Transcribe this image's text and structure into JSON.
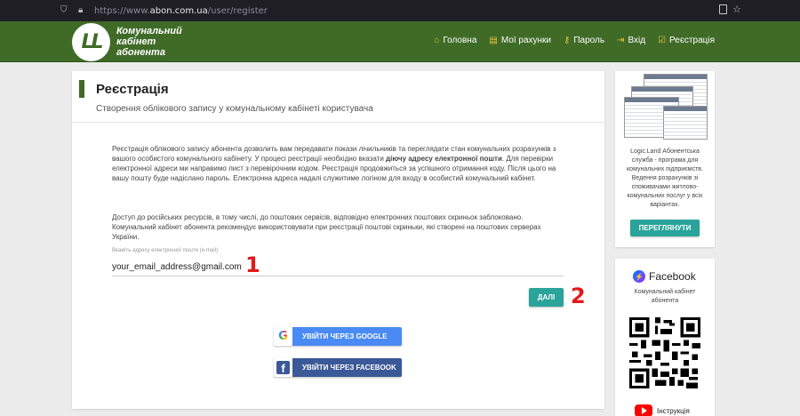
{
  "browser": {
    "url_prefix": "https://www.",
    "url_domain": "abon.com.ua",
    "url_path": "/user/register"
  },
  "header": {
    "logo_mark": "LL",
    "logo_line1": "Комунальний",
    "logo_line2": "кабінет",
    "logo_line3": "абонента",
    "nav": [
      {
        "label": "Головна",
        "icon": "home-icon"
      },
      {
        "label": "Мої рахунки",
        "icon": "receipt-icon"
      },
      {
        "label": "Пароль",
        "icon": "key-icon"
      },
      {
        "label": "Вхід",
        "icon": "login-icon"
      },
      {
        "label": "Реєстрація",
        "icon": "check-icon"
      }
    ]
  },
  "main": {
    "title": "Реєстрація",
    "subtitle": "Створення облікового запису у комунальному кабінеті користувача",
    "description_part1": "Реєстрація облікового запису абонента дозволить вам передавати покази лічильників та переглядати стан комунальних розрахунків з вашого особистого комунального кабінету. У процесі реєстрації необхідно вказати ",
    "description_bold": "діючу адресу електронної пошти",
    "description_part2": ". Для перевірки електронної адреси ми направимо лист з перевірочним кодом. Реєстрація продовжиться за успішного отримання коду. Після цього на вашу пошту буде надіслано пароль. Електронна адреса надалі служитиме логіном для входу в особистий комунальний кабінет.",
    "description2": "Доступ до російських ресурсів, в тому числі, до поштових сервісів, відповідно електронних поштових скриньок заблоковано. Комунальний кабінет абонента рекомендує використовувати при реєстрації поштові скриньки, які створені на поштових серверах України.",
    "email_label": "Вкажіть адресу електронної пошти (e-mail)",
    "email_value": "your_email_address@gmail.com",
    "next_button": "ДАЛІ",
    "annotation_1": "1",
    "annotation_2": "2",
    "google_button": "УВІЙТИ ЧЕРЕЗ GOOGLE",
    "facebook_button": "УВІЙТИ ЧЕРЕЗ FACEBOOK",
    "google_mark": "G",
    "facebook_mark": "f"
  },
  "sidebar": {
    "promo_text": "Logic.Land Абонентська служба - програма для комунальних підприємств. Ведення розрахунків зі споживачами житлово-комунальних послуг у всіх варіантах.",
    "view_button": "ПЕРЕГЛЯНУТИ",
    "facebook_title": "Facebook",
    "facebook_subtitle": "Комунальний кабінет абонента",
    "youtube_label": "Інструкція"
  },
  "colors": {
    "brand_green": "#3f6b27",
    "teal_button": "#2aa39a",
    "google_blue": "#4a8af4",
    "facebook_blue": "#3b5998",
    "annotation_red": "#e21a1a"
  }
}
